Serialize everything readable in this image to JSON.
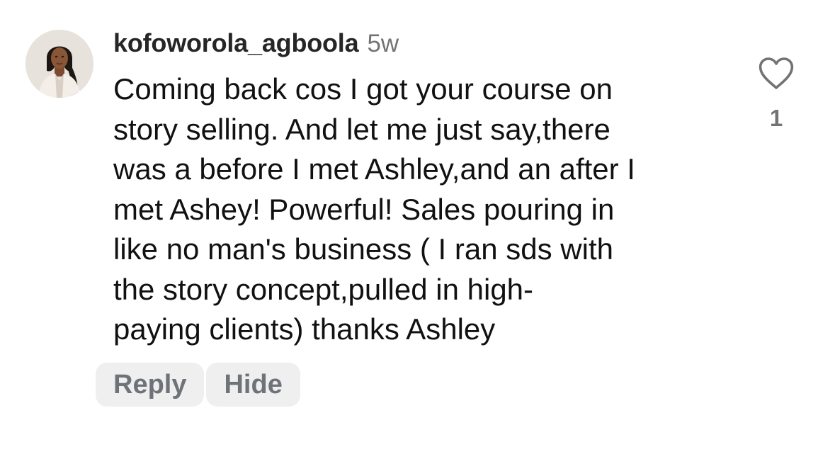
{
  "comment": {
    "username": "kofoworola_agboola",
    "time": "5w",
    "avatar_icon": "profile-photo",
    "text_lines": [
      "Coming back cos I got your course on",
      "story selling. And let me just say,there",
      "was a before I met Ashley,and an after I",
      "met Ashey! Powerful! Sales pouring in",
      "like no man's business ( I ran sds with",
      "the story concept,pulled in high-",
      "paying clients) thanks Ashley"
    ],
    "like_icon": "heart-outline-icon",
    "like_count": "1",
    "actions": {
      "reply_label": "Reply",
      "hide_label": "Hide"
    }
  },
  "colors": {
    "username": "#262626",
    "meta": "#737373",
    "body_text": "#111111",
    "pill_background": "#efefef",
    "pill_text": "#6f7379"
  }
}
